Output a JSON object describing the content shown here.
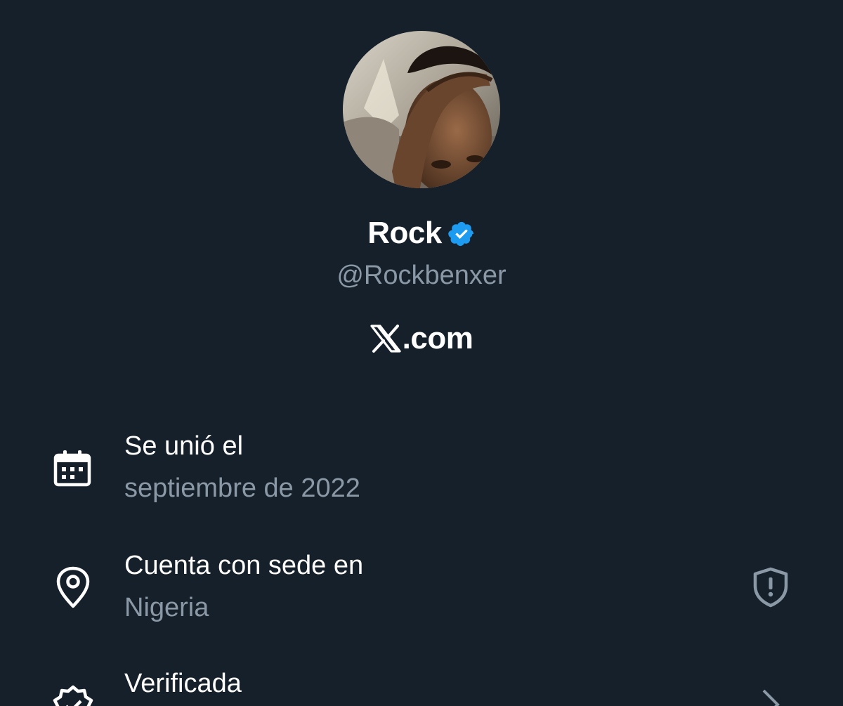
{
  "profile": {
    "display_name": "Rock",
    "handle": "@Rockbenxer",
    "verified_color": "#1d9bf0"
  },
  "site": {
    "logo": "x-logo-icon",
    "suffix": ".com"
  },
  "details": {
    "joined": {
      "icon": "calendar-icon",
      "title": "Se unió el",
      "value": "septiembre de 2022"
    },
    "location": {
      "icon": "location-pin-icon",
      "title": "Cuenta con sede en",
      "value": "Nigeria",
      "trailing_icon": "shield-alert-icon"
    },
    "verified": {
      "icon": "verified-outline-icon",
      "title": "Verificada",
      "trailing_icon": "chevron-right-icon"
    }
  },
  "colors": {
    "background": "#15202b",
    "primary_text": "#ffffff",
    "secondary_text": "#8b98a5",
    "accent": "#1d9bf0"
  }
}
